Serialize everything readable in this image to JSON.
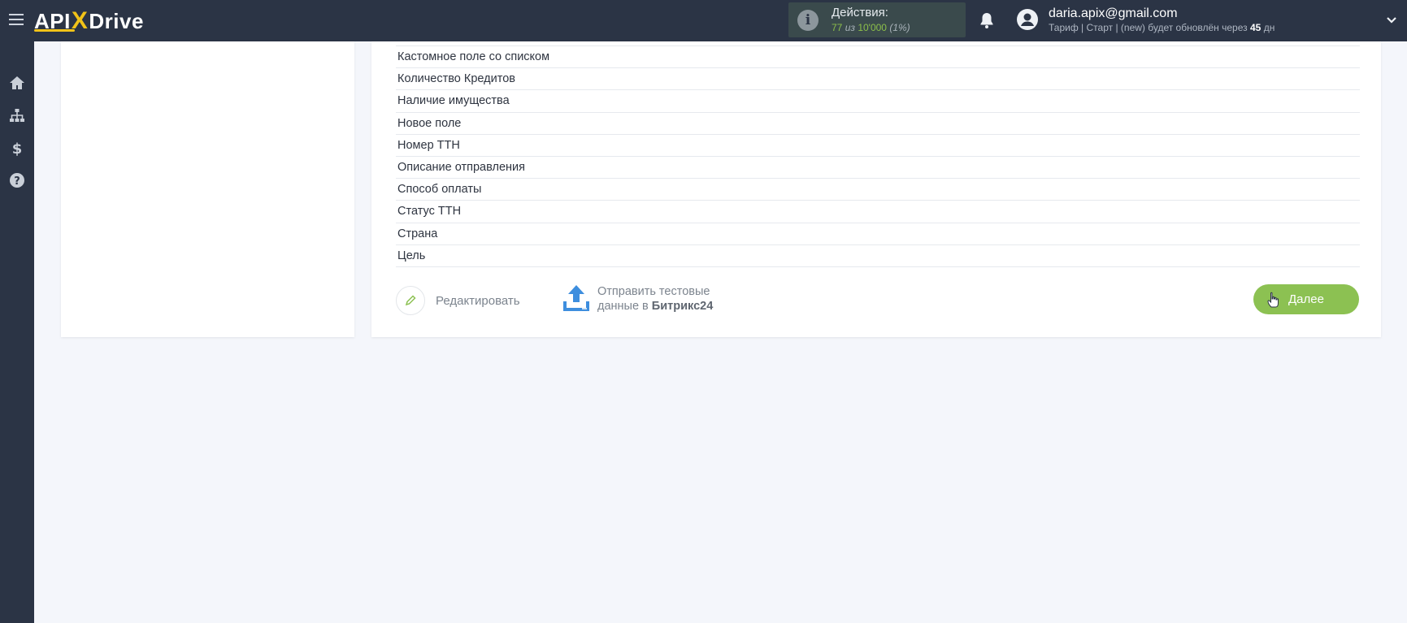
{
  "header": {
    "logo": {
      "left": "API",
      "x": "X",
      "right": "Drive"
    },
    "actions": {
      "label": "Действия:",
      "used": "77",
      "of_text": "из",
      "total": "10'000",
      "percent": "(1%)"
    },
    "user": {
      "email": "daria.apix@gmail.com",
      "tariff_prefix": "Тариф | Старт | (new) будет обновлён через",
      "days": "45",
      "days_suffix": "дн"
    }
  },
  "sidebar": {
    "items": [
      {
        "name": "home",
        "icon": "home-icon"
      },
      {
        "name": "structure",
        "icon": "sitemap-icon"
      },
      {
        "name": "billing",
        "icon": "dollar-icon"
      },
      {
        "name": "help",
        "icon": "question-icon"
      }
    ]
  },
  "fields": [
    "Кастомное поле со списком",
    "Количество Кредитов",
    "Наличие имущества",
    "Новое поле",
    "Номер ТТН",
    "Описание отправления",
    "Способ оплаты",
    "Статус ТТН",
    "Страна",
    "Цель"
  ],
  "footer": {
    "edit_label": "Редактировать",
    "send_line1": "Отправить тестовые",
    "send_line2_prefix": "данные в",
    "send_target": "Битрикс24",
    "next_label": "Далее"
  },
  "colors": {
    "topbar": "#2b3445",
    "accent_yellow": "#f2c318",
    "next_green": "#8cc152",
    "upload_blue": "#3e8ede"
  }
}
